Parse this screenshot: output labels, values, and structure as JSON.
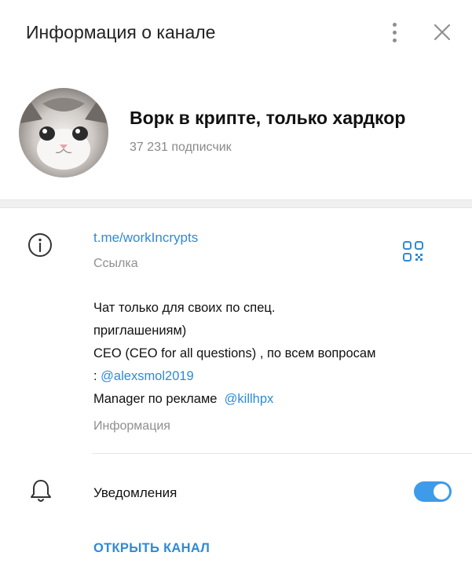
{
  "header": {
    "title": "Информация о канале",
    "menu_icon": "more-vertical-icon",
    "close_icon": "close-icon"
  },
  "profile": {
    "avatar": "cat-avatar",
    "name": "Ворк в крипте, только хардкор",
    "subscribers": "37 231 подписчик"
  },
  "info": {
    "icon": "info-icon",
    "link": "t.me/workIncrypts",
    "link_label": "Ссылка",
    "qr_icon": "qr-code-icon",
    "description_line1": "Чат только для своих по спец.",
    "description_line2": "приглашениям)",
    "description_line3": "CEO (CEO for all questions) , по всем вопросам",
    "description_prefix4": ": ",
    "mention1": "@alexsmol2019",
    "description_prefix5": "Manager по рекламе  ",
    "mention2": "@killhpx",
    "description_label": "Информация"
  },
  "notifications": {
    "icon": "bell-icon",
    "label": "Уведомления",
    "enabled": true
  },
  "actions": {
    "open_channel": "ОТКРЫТЬ КАНАЛ"
  },
  "colors": {
    "accent": "#2f8ad6",
    "toggle": "#3d9be9",
    "secondary_text": "#8f8f8f"
  }
}
